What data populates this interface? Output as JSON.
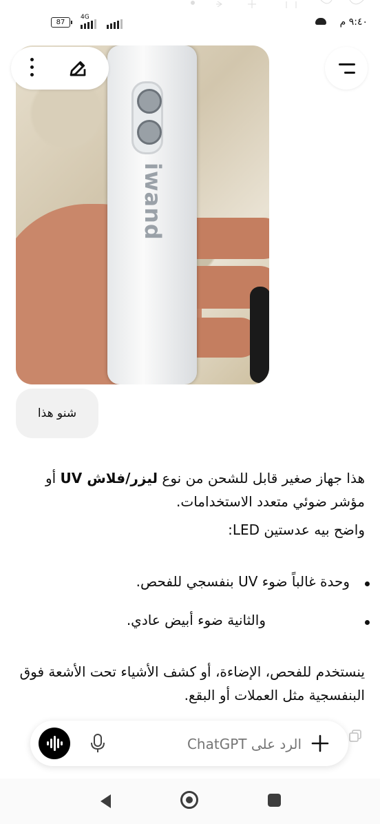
{
  "status_bar": {
    "battery": "87",
    "network": "4G",
    "time": "٩:٤٠ م"
  },
  "message_image": {
    "alt": "",
    "brand_text": "iwand"
  },
  "user_message": {
    "text": "شنو هذا"
  },
  "assistant_message": {
    "p1_a": "هذا جهاز صغير قابل للشحن من نوع ",
    "p1_bold": "ليزر/فلاش UV",
    "p1_b": " أو مؤشر ضوئي متعدد الاستخدامات.",
    "p2": "واضح بيه عدستين LED:",
    "bullets": [
      "وحدة غالباً ضوء UV بنفسجي للفحص.",
      "والثانية ضوء أبيض عادي."
    ],
    "p3": "ينستخدم للفحص، الإضاءة، أو كشف الأشياء تحت الأشعة فوق البنفسجية مثل العملات أو البقع."
  },
  "composer": {
    "placeholder": "الرد على ChatGPT"
  },
  "icons": {
    "menu": "menu-icon",
    "kebab": "more-vertical-icon",
    "edit": "edit-icon",
    "voice": "voice-mode-icon",
    "mic": "mic-icon",
    "plus": "plus-icon",
    "copy": "copy-icon"
  }
}
